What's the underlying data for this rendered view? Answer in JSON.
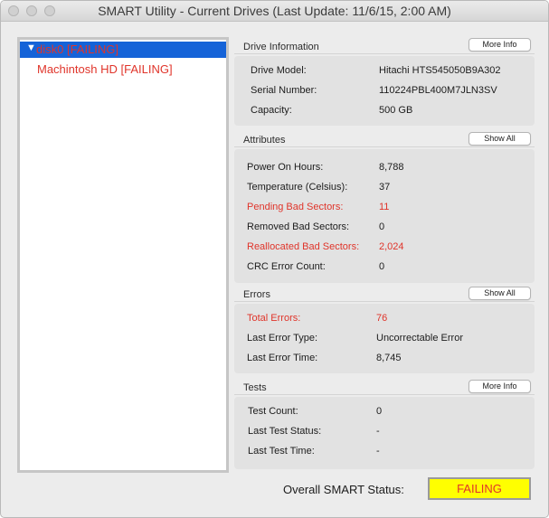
{
  "window": {
    "title": "SMART Utility - Current Drives (Last Update: 11/6/15, 2:00 AM)"
  },
  "drives": [
    {
      "label": "disk0  [FAILING]",
      "selected": true
    },
    {
      "label": "Machintosh HD  [FAILING]",
      "selected": false
    }
  ],
  "drive_info": {
    "title": "Drive Information",
    "button": "More Info",
    "rows": [
      {
        "label": "Drive Model:",
        "value": "Hitachi HTS545050B9A302"
      },
      {
        "label": "Serial Number:",
        "value": "110224PBL400M7JLN3SV"
      },
      {
        "label": "Capacity:",
        "value": "500 GB"
      }
    ]
  },
  "attributes": {
    "title": "Attributes",
    "button": "Show All",
    "rows": [
      {
        "label": "Power On Hours:",
        "value": "8,788",
        "alert": false
      },
      {
        "label": "Temperature (Celsius):",
        "value": "37",
        "alert": false
      },
      {
        "label": "Pending Bad Sectors:",
        "value": "11",
        "alert": true
      },
      {
        "label": "Removed Bad Sectors:",
        "value": "0",
        "alert": false
      },
      {
        "label": "Reallocated Bad Sectors:",
        "value": "2,024",
        "alert": true
      },
      {
        "label": "CRC Error Count:",
        "value": "0",
        "alert": false
      }
    ]
  },
  "errors": {
    "title": "Errors",
    "button": "Show All",
    "rows": [
      {
        "label": "Total Errors:",
        "value": "76",
        "alert": true
      },
      {
        "label": "Last Error Type:",
        "value": "Uncorrectable Error",
        "alert": false
      },
      {
        "label": "Last Error Time:",
        "value": "8,745",
        "alert": false
      }
    ]
  },
  "tests": {
    "title": "Tests",
    "button": "More Info",
    "rows": [
      {
        "label": "Test Count:",
        "value": "0"
      },
      {
        "label": "Last Test Status:",
        "value": "-"
      },
      {
        "label": "Last Test Time:",
        "value": "-"
      }
    ]
  },
  "overall": {
    "label": "Overall SMART Status:",
    "status": "FAILING"
  },
  "colors": {
    "failing": "#e0342a",
    "selection": "#1563d8",
    "status_badge": "#ffff00"
  }
}
